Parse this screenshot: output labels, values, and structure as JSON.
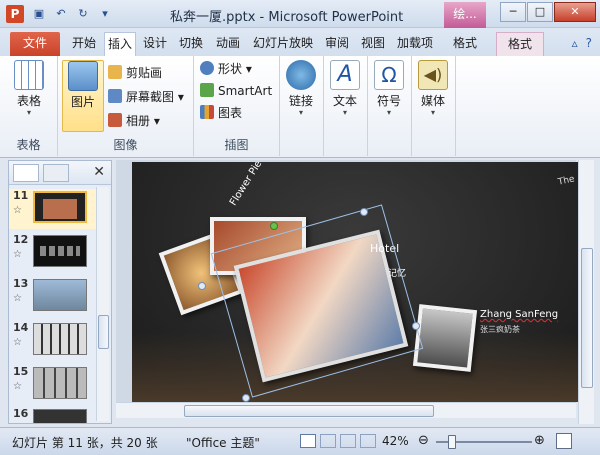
{
  "titlebar": {
    "title": "私奔一厦.pptx - Microsoft PowerPoint",
    "context_tab": "绘...",
    "app_icon": "P"
  },
  "tabs": [
    "文件",
    "开始",
    "插入",
    "设计",
    "切换",
    "动画",
    "幻灯片放映",
    "审阅",
    "视图",
    "加载项",
    "格式",
    "格式"
  ],
  "ribbon": {
    "groups": {
      "table": {
        "label": "表格",
        "btn": "表格"
      },
      "image": {
        "label": "图像",
        "picture": "图片",
        "clipart": "剪贴画",
        "screenshot": "屏幕截图",
        "album": "相册"
      },
      "illustration": {
        "label": "插图",
        "shapes": "形状",
        "smartart": "SmartArt",
        "chart": "图表"
      },
      "links": {
        "btn": "链接"
      },
      "text": {
        "btn": "文本"
      },
      "symbols": {
        "btn": "符号"
      },
      "media": {
        "btn": "媒体"
      }
    }
  },
  "slides": {
    "items": [
      {
        "num": "11",
        "selected": true
      },
      {
        "num": "12"
      },
      {
        "num": "13"
      },
      {
        "num": "14"
      },
      {
        "num": "15"
      },
      {
        "num": "16"
      }
    ],
    "star": "☆"
  },
  "slide_content": {
    "caption_pie": "Flower Pie & Cookie",
    "caption_hotel": "Hotel",
    "caption_name": "Zhang SanFeng",
    "caption_sub": "张三疯奶茶",
    "caption_memory": "记忆",
    "corner": "The"
  },
  "status": {
    "slide_info": "幻灯片 第 11 张，共 20 张",
    "theme": "\"Office 主题\"",
    "zoom": "42%"
  }
}
